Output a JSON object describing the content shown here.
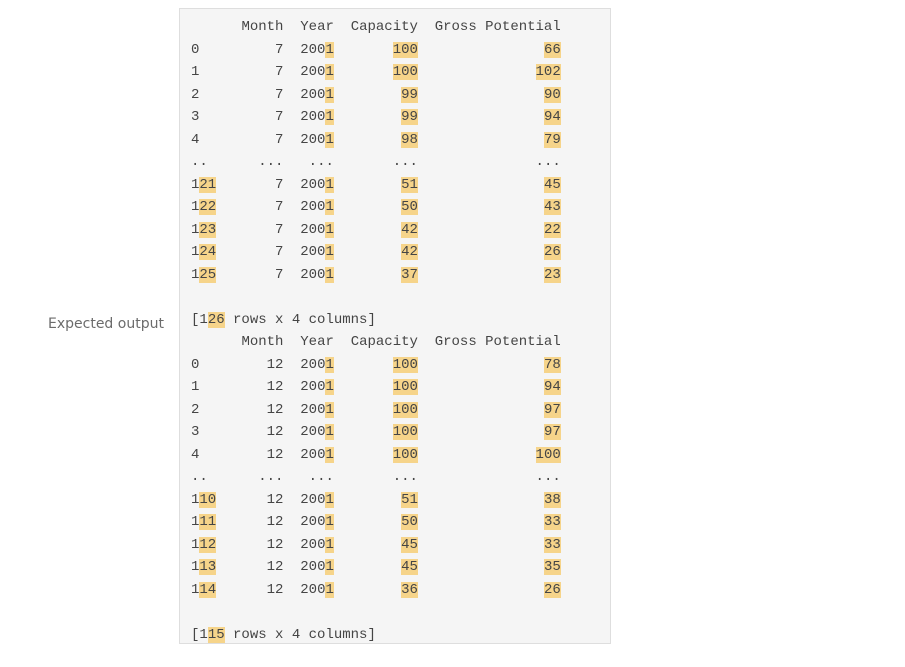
{
  "label": "Expected output",
  "highlight_color": "#f6d48a",
  "tables": [
    {
      "header": [
        "Month",
        "Year",
        "Capacity",
        "Gross Potential"
      ],
      "rows": [
        [
          "0",
          "7",
          "2001",
          "100",
          "66"
        ],
        [
          "1",
          "7",
          "2001",
          "100",
          "102"
        ],
        [
          "2",
          "7",
          "2001",
          "99",
          "90"
        ],
        [
          "3",
          "7",
          "2001",
          "99",
          "94"
        ],
        [
          "4",
          "7",
          "2001",
          "98",
          "79"
        ],
        [
          "..",
          "...",
          "...",
          "...",
          "..."
        ],
        [
          "121",
          "7",
          "2001",
          "51",
          "45"
        ],
        [
          "122",
          "7",
          "2001",
          "50",
          "43"
        ],
        [
          "123",
          "7",
          "2001",
          "42",
          "22"
        ],
        [
          "124",
          "7",
          "2001",
          "42",
          "26"
        ],
        [
          "125",
          "7",
          "2001",
          "37",
          "23"
        ]
      ],
      "summary_prefix": "[",
      "summary_count": "126",
      "summary_suffix": " rows x 4 columns]"
    },
    {
      "header": [
        "Month",
        "Year",
        "Capacity",
        "Gross Potential"
      ],
      "rows": [
        [
          "0",
          "12",
          "2001",
          "100",
          "78"
        ],
        [
          "1",
          "12",
          "2001",
          "100",
          "94"
        ],
        [
          "2",
          "12",
          "2001",
          "100",
          "97"
        ],
        [
          "3",
          "12",
          "2001",
          "100",
          "97"
        ],
        [
          "4",
          "12",
          "2001",
          "100",
          "100"
        ],
        [
          "..",
          "...",
          "...",
          "...",
          "..."
        ],
        [
          "110",
          "12",
          "2001",
          "51",
          "38"
        ],
        [
          "111",
          "12",
          "2001",
          "50",
          "33"
        ],
        [
          "112",
          "12",
          "2001",
          "45",
          "33"
        ],
        [
          "113",
          "12",
          "2001",
          "45",
          "35"
        ],
        [
          "114",
          "12",
          "2001",
          "36",
          "26"
        ]
      ],
      "summary_prefix": "[",
      "summary_count": "115",
      "summary_suffix": " rows x 4 columns]"
    }
  ]
}
